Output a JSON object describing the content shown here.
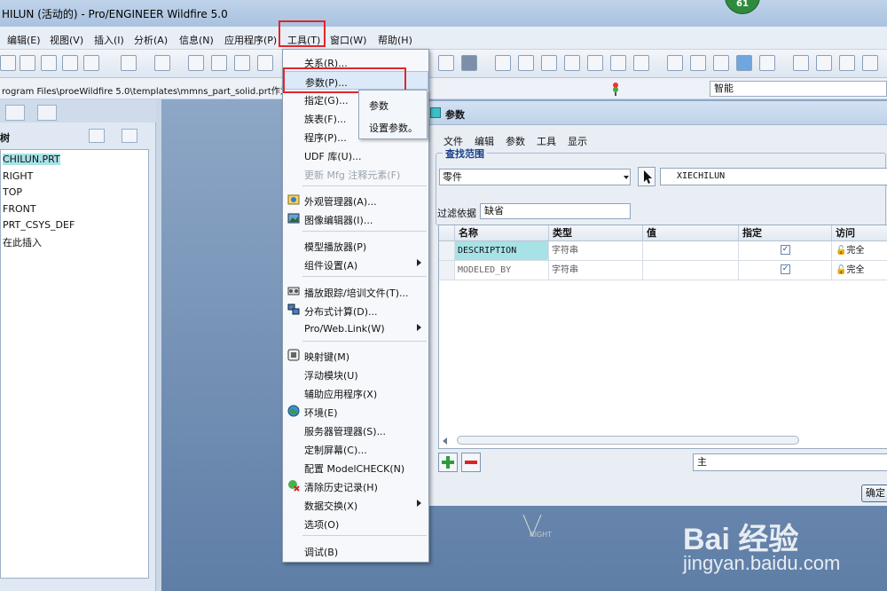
{
  "titlebar": {
    "title": "HILUN (活动的) - Pro/ENGINEER Wildfire 5.0",
    "badge": "61"
  },
  "menubar": {
    "items": [
      {
        "label": "编辑(E)"
      },
      {
        "label": "视图(V)"
      },
      {
        "label": "插入(I)"
      },
      {
        "label": "分析(A)"
      },
      {
        "label": "信息(N)"
      },
      {
        "label": "应用程序(P)"
      },
      {
        "label": "工具(T)"
      },
      {
        "label": "窗口(W)"
      },
      {
        "label": "帮助(H)"
      }
    ]
  },
  "pathbar": {
    "path": "rogram Files\\proeWildfire 5.0\\templates\\mmns_part_solid.prt作为模",
    "selection_filter": "智能"
  },
  "tree": {
    "title": "树",
    "nodes": [
      "CHILUN.PRT",
      "RIGHT",
      "TOP",
      "FRONT",
      "PRT_CSYS_DEF",
      "在此插入"
    ]
  },
  "tools_menu": {
    "items": [
      {
        "label": "关系(R)...",
        "icon": "",
        "disabled": false,
        "submenu": false
      },
      {
        "label": "参数(P)...",
        "icon": "",
        "disabled": false,
        "submenu": false,
        "highlighted": true
      },
      {
        "label": "指定(G)...",
        "icon": "",
        "disabled": false,
        "submenu": false
      },
      {
        "label": "族表(F)...",
        "icon": "",
        "disabled": false,
        "submenu": false
      },
      {
        "label": "程序(P)...",
        "icon": "",
        "disabled": false,
        "submenu": false
      },
      {
        "label": "UDF 库(U)...",
        "icon": "",
        "disabled": false,
        "submenu": false
      },
      {
        "label": "更新 Mfg 注释元素(F)",
        "icon": "",
        "disabled": true,
        "submenu": false
      },
      {
        "label": "外观管理器(A)...",
        "icon": "appearance-icon",
        "disabled": false,
        "submenu": false
      },
      {
        "label": "图像编辑器(I)...",
        "icon": "image-editor-icon",
        "disabled": false,
        "submenu": false
      },
      {
        "label": "模型播放器(P)",
        "icon": "",
        "disabled": false,
        "submenu": false
      },
      {
        "label": "组件设置(A)",
        "icon": "",
        "disabled": false,
        "submenu": true
      },
      {
        "label": "播放跟踪/培训文件(T)...",
        "icon": "trail-icon",
        "disabled": false,
        "submenu": false
      },
      {
        "label": "分布式计算(D)...",
        "icon": "distributed-icon",
        "disabled": false,
        "submenu": false
      },
      {
        "label": "Pro/Web.Link(W)",
        "icon": "",
        "disabled": false,
        "submenu": true
      },
      {
        "label": "映射键(M)",
        "icon": "mapkey-icon",
        "disabled": false,
        "submenu": false
      },
      {
        "label": "浮动模块(U)",
        "icon": "",
        "disabled": false,
        "submenu": false
      },
      {
        "label": "辅助应用程序(X)",
        "icon": "",
        "disabled": false,
        "submenu": false
      },
      {
        "label": "环境(E)",
        "icon": "environment-icon",
        "disabled": false,
        "submenu": false
      },
      {
        "label": "服务器管理器(S)...",
        "icon": "",
        "disabled": false,
        "submenu": false
      },
      {
        "label": "定制屏幕(C)...",
        "icon": "",
        "disabled": false,
        "submenu": false
      },
      {
        "label": "配置 ModelCHECK(N)",
        "icon": "",
        "disabled": false,
        "submenu": false
      },
      {
        "label": "清除历史记录(H)",
        "icon": "clear-history-icon",
        "disabled": false,
        "submenu": false
      },
      {
        "label": "数据交换(X)",
        "icon": "",
        "disabled": false,
        "submenu": true
      },
      {
        "label": "选项(O)",
        "icon": "",
        "disabled": false,
        "submenu": false
      },
      {
        "label": "调试(B)",
        "icon": "",
        "disabled": false,
        "submenu": false
      }
    ]
  },
  "tooltip": {
    "line1": "参数",
    "line2": "设置参数。"
  },
  "param_dialog": {
    "title": "参数",
    "menu": [
      "文件",
      "编辑",
      "参数",
      "工具",
      "显示"
    ],
    "lookup_legend": "查找范围",
    "scope": "零件",
    "model": "XIECHILUN",
    "filter_label": "过滤依据",
    "filter_value": "缺省",
    "columns": [
      "名称",
      "类型",
      "值",
      "指定",
      "访问"
    ],
    "rows": [
      {
        "name": "DESCRIPTION",
        "type": "字符串",
        "value": "",
        "designated": true,
        "access": "完全"
      },
      {
        "name": "MODELED_BY",
        "type": "字符串",
        "value": "",
        "designated": true,
        "access": "完全"
      }
    ],
    "main_field": "主",
    "ok": "确定"
  },
  "graphics": {
    "datum_label": "RIGHT"
  },
  "watermark": {
    "line1": "Bai 经验",
    "line2": "jingyan.baidu.com"
  },
  "colors": {
    "highlight_box": "#e2262d",
    "selected_row": "#a7e2e6",
    "accent": "#2e8b3e"
  }
}
